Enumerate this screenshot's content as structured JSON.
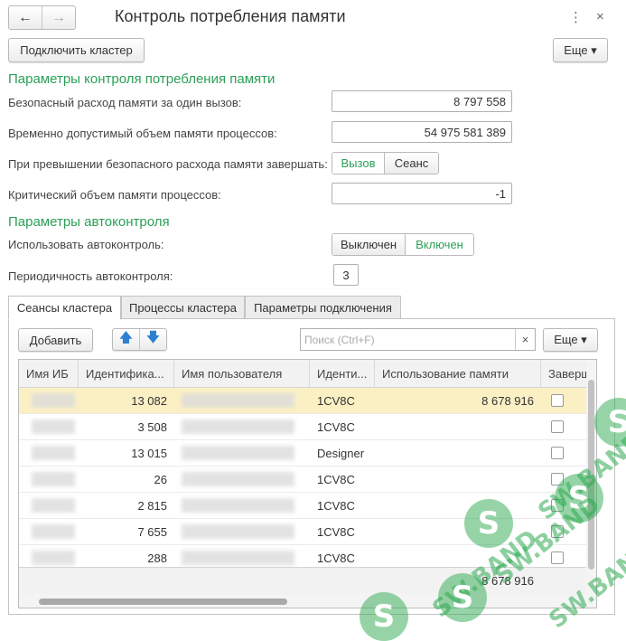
{
  "window": {
    "title": "Контроль потребления памяти",
    "back_icon": "arrow-left-icon",
    "forward_icon": "arrow-right-icon",
    "menu_icon": "more-vertical-icon",
    "close_icon": "close-icon"
  },
  "toolbar": {
    "connect_label": "Подключить кластер",
    "more_label": "Еще ▾"
  },
  "memory_section": {
    "heading": "Параметры контроля потребления памяти",
    "safe_per_call_label": "Безопасный расход памяти за один вызов:",
    "safe_per_call_value": "8 797 558",
    "temp_allowed_label": "Временно допустимый объем памяти процессов:",
    "temp_allowed_value": "54 975 581 389",
    "on_exceed_label": "При превышении безопасного расхода памяти завершать:",
    "on_exceed_options": [
      "Вызов",
      "Сеанс"
    ],
    "on_exceed_selected": "Вызов",
    "critical_label": "Критический объем памяти процессов:",
    "critical_value": "-1"
  },
  "auto_section": {
    "heading": "Параметры автоконтроля",
    "use_auto_label": "Использовать автоконтроль:",
    "use_auto_options": [
      "Выключен",
      "Включен"
    ],
    "use_auto_selected": "Включен",
    "period_label": "Периодичность автоконтроля:",
    "period_value": "3"
  },
  "tabs": [
    "Сеансы кластера",
    "Процессы кластера",
    "Параметры подключения"
  ],
  "active_tab": "Сеансы кластера",
  "sessions": {
    "add_label": "Добавить",
    "search_placeholder": "Поиск (Ctrl+F)",
    "search_clear": "×",
    "more_label": "Еще ▾",
    "columns": [
      "Имя ИБ",
      "Идентифика...",
      "Имя пользователя",
      "Иденти...",
      "Использование памяти",
      "Заверш"
    ],
    "rows": [
      {
        "id": "13 082",
        "app": "1CV8C",
        "memory": "8 678 916"
      },
      {
        "id": "3 508",
        "app": "1CV8C",
        "memory": ""
      },
      {
        "id": "13 015",
        "app": "Designer",
        "memory": ""
      },
      {
        "id": "26",
        "app": "1CV8C",
        "memory": ""
      },
      {
        "id": "2 815",
        "app": "1CV8C",
        "memory": ""
      },
      {
        "id": "7 655",
        "app": "1CV8C",
        "memory": ""
      },
      {
        "id": "288",
        "app": "1CV8C",
        "memory": ""
      }
    ],
    "total_memory": "8 678 916"
  },
  "watermark": {
    "text": "SW.BAND",
    "mark": "S"
  },
  "colors": {
    "accent": "#2c9f57",
    "selected_row": "#fbefc4"
  }
}
